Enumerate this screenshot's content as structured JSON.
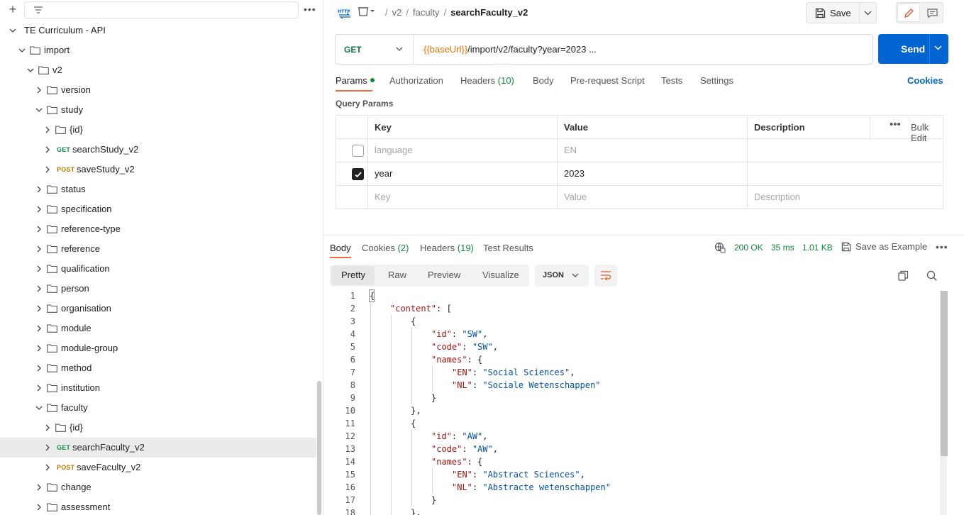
{
  "sidebar": {
    "add_icon": "plus-icon",
    "filter_icon": "filter-lines-icon",
    "more": "•••",
    "tree": [
      {
        "label": "TE Curriculum - API",
        "depth": 0,
        "open": true,
        "type": "collection"
      },
      {
        "label": "import",
        "depth": 1,
        "open": true,
        "type": "folder"
      },
      {
        "label": "v2",
        "depth": 2,
        "open": true,
        "type": "folder"
      },
      {
        "label": "version",
        "depth": 3,
        "open": false,
        "type": "folder"
      },
      {
        "label": "study",
        "depth": 3,
        "open": true,
        "type": "folder"
      },
      {
        "label": "{id}",
        "depth": 4,
        "open": false,
        "type": "folder"
      },
      {
        "label": "searchStudy_v2",
        "depth": 4,
        "open": false,
        "type": "request",
        "method": "GET"
      },
      {
        "label": "saveStudy_v2",
        "depth": 4,
        "open": false,
        "type": "request",
        "method": "POST"
      },
      {
        "label": "status",
        "depth": 3,
        "open": false,
        "type": "folder"
      },
      {
        "label": "specification",
        "depth": 3,
        "open": false,
        "type": "folder"
      },
      {
        "label": "reference-type",
        "depth": 3,
        "open": false,
        "type": "folder"
      },
      {
        "label": "reference",
        "depth": 3,
        "open": false,
        "type": "folder"
      },
      {
        "label": "qualification",
        "depth": 3,
        "open": false,
        "type": "folder"
      },
      {
        "label": "person",
        "depth": 3,
        "open": false,
        "type": "folder"
      },
      {
        "label": "organisation",
        "depth": 3,
        "open": false,
        "type": "folder"
      },
      {
        "label": "module",
        "depth": 3,
        "open": false,
        "type": "folder"
      },
      {
        "label": "module-group",
        "depth": 3,
        "open": false,
        "type": "folder"
      },
      {
        "label": "method",
        "depth": 3,
        "open": false,
        "type": "folder"
      },
      {
        "label": "institution",
        "depth": 3,
        "open": false,
        "type": "folder"
      },
      {
        "label": "faculty",
        "depth": 3,
        "open": true,
        "type": "folder"
      },
      {
        "label": "{id}",
        "depth": 4,
        "open": false,
        "type": "folder"
      },
      {
        "label": "searchFaculty_v2",
        "depth": 4,
        "open": false,
        "type": "request",
        "method": "GET",
        "selected": true
      },
      {
        "label": "saveFaculty_v2",
        "depth": 4,
        "open": false,
        "type": "request",
        "method": "POST"
      },
      {
        "label": "change",
        "depth": 3,
        "open": false,
        "type": "folder"
      },
      {
        "label": "assessment",
        "depth": 3,
        "open": false,
        "type": "folder"
      }
    ]
  },
  "header": {
    "breadcrumb": [
      "v2",
      "faculty"
    ],
    "current": "searchFaculty_v2",
    "save_label": "Save"
  },
  "request": {
    "method": "GET",
    "url_var": "{{baseUrl}}",
    "url_rest": "/import/v2/faculty?year=2023 ...",
    "send_label": "Send",
    "tabs": [
      {
        "label": "Params",
        "active": true,
        "dot": true
      },
      {
        "label": "Authorization"
      },
      {
        "label": "Headers",
        "count": "(10)"
      },
      {
        "label": "Body"
      },
      {
        "label": "Pre-request Script"
      },
      {
        "label": "Tests"
      },
      {
        "label": "Settings"
      }
    ],
    "cookies_label": "Cookies"
  },
  "query_params": {
    "title": "Query Params",
    "columns": [
      "Key",
      "Value",
      "Description"
    ],
    "bulk_edit": "Bulk Edit",
    "rows": [
      {
        "checked": false,
        "key": "language",
        "value": "EN",
        "description": "",
        "disabled": true
      },
      {
        "checked": true,
        "key": "year",
        "value": "2023",
        "description": ""
      }
    ],
    "placeholder": {
      "key": "Key",
      "value": "Value",
      "description": "Description"
    }
  },
  "response": {
    "tabs": [
      {
        "label": "Body",
        "active": true
      },
      {
        "label": "Cookies",
        "count": "(2)"
      },
      {
        "label": "Headers",
        "count": "(19)"
      },
      {
        "label": "Test Results"
      }
    ],
    "status": "200 OK",
    "time": "35 ms",
    "size": "1.01 KB",
    "save_example": "Save as Example",
    "formats": [
      "Pretty",
      "Raw",
      "Preview",
      "Visualize"
    ],
    "language": "JSON",
    "code": [
      {
        "n": "1",
        "i": 0,
        "t": [
          [
            "p",
            "{"
          ]
        ]
      },
      {
        "n": "2",
        "i": 1,
        "t": [
          [
            "k",
            "\"content\""
          ],
          [
            "p",
            ": ["
          ]
        ]
      },
      {
        "n": "3",
        "i": 2,
        "t": [
          [
            "p",
            "{"
          ]
        ]
      },
      {
        "n": "4",
        "i": 3,
        "t": [
          [
            "k",
            "\"id\""
          ],
          [
            "p",
            ": "
          ],
          [
            "s",
            "\"SW\""
          ],
          [
            "p",
            ","
          ]
        ]
      },
      {
        "n": "5",
        "i": 3,
        "t": [
          [
            "k",
            "\"code\""
          ],
          [
            "p",
            ": "
          ],
          [
            "s",
            "\"SW\""
          ],
          [
            "p",
            ","
          ]
        ]
      },
      {
        "n": "6",
        "i": 3,
        "t": [
          [
            "k",
            "\"names\""
          ],
          [
            "p",
            ": {"
          ]
        ]
      },
      {
        "n": "7",
        "i": 4,
        "t": [
          [
            "k",
            "\"EN\""
          ],
          [
            "p",
            ": "
          ],
          [
            "s",
            "\"Social Sciences\""
          ],
          [
            "p",
            ","
          ]
        ]
      },
      {
        "n": "8",
        "i": 4,
        "t": [
          [
            "k",
            "\"NL\""
          ],
          [
            "p",
            ": "
          ],
          [
            "s",
            "\"Sociale Wetenschappen\""
          ]
        ]
      },
      {
        "n": "9",
        "i": 3,
        "t": [
          [
            "p",
            "}"
          ]
        ]
      },
      {
        "n": "10",
        "i": 2,
        "t": [
          [
            "p",
            "},"
          ]
        ]
      },
      {
        "n": "11",
        "i": 2,
        "t": [
          [
            "p",
            "{"
          ]
        ]
      },
      {
        "n": "12",
        "i": 3,
        "t": [
          [
            "k",
            "\"id\""
          ],
          [
            "p",
            ": "
          ],
          [
            "s",
            "\"AW\""
          ],
          [
            "p",
            ","
          ]
        ]
      },
      {
        "n": "13",
        "i": 3,
        "t": [
          [
            "k",
            "\"code\""
          ],
          [
            "p",
            ": "
          ],
          [
            "s",
            "\"AW\""
          ],
          [
            "p",
            ","
          ]
        ]
      },
      {
        "n": "14",
        "i": 3,
        "t": [
          [
            "k",
            "\"names\""
          ],
          [
            "p",
            ": {"
          ]
        ]
      },
      {
        "n": "15",
        "i": 4,
        "t": [
          [
            "k",
            "\"EN\""
          ],
          [
            "p",
            ": "
          ],
          [
            "s",
            "\"Abstract Sciences\""
          ],
          [
            "p",
            ","
          ]
        ]
      },
      {
        "n": "16",
        "i": 4,
        "t": [
          [
            "k",
            "\"NL\""
          ],
          [
            "p",
            ": "
          ],
          [
            "s",
            "\"Abstracte wetenschappen\""
          ]
        ]
      },
      {
        "n": "17",
        "i": 3,
        "t": [
          [
            "p",
            "}"
          ]
        ]
      },
      {
        "n": "18",
        "i": 2,
        "t": [
          [
            "p",
            "},"
          ]
        ]
      }
    ]
  }
}
